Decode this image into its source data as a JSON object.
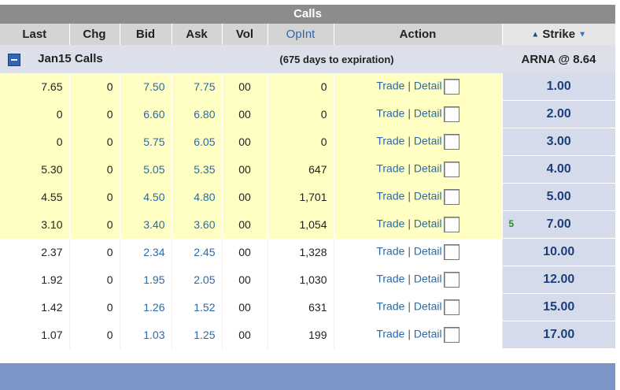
{
  "header": {
    "title": "Calls"
  },
  "columns": {
    "last": "Last",
    "chg": "Chg",
    "bid": "Bid",
    "ask": "Ask",
    "vol": "Vol",
    "oi": "OpInt",
    "action": "Action",
    "strike": "Strike"
  },
  "group": {
    "label": "Jan15 Calls",
    "expiration": "(675 days to expiration)",
    "underlying": "ARNA @ 8.64"
  },
  "action": {
    "trade": "Trade",
    "separator": "|",
    "detail": "Detail"
  },
  "rows": [
    {
      "last": "7.65",
      "chg": "0",
      "bid": "7.50",
      "ask": "7.75",
      "vol": "00",
      "oi": "0",
      "strike": "1.00",
      "marker": ""
    },
    {
      "last": "0",
      "chg": "0",
      "bid": "6.60",
      "ask": "6.80",
      "vol": "00",
      "oi": "0",
      "strike": "2.00",
      "marker": ""
    },
    {
      "last": "0",
      "chg": "0",
      "bid": "5.75",
      "ask": "6.05",
      "vol": "00",
      "oi": "0",
      "strike": "3.00",
      "marker": ""
    },
    {
      "last": "5.30",
      "chg": "0",
      "bid": "5.05",
      "ask": "5.35",
      "vol": "00",
      "oi": "647",
      "strike": "4.00",
      "marker": ""
    },
    {
      "last": "4.55",
      "chg": "0",
      "bid": "4.50",
      "ask": "4.80",
      "vol": "00",
      "oi": "1,701",
      "strike": "5.00",
      "marker": ""
    },
    {
      "last": "3.10",
      "chg": "0",
      "bid": "3.40",
      "ask": "3.60",
      "vol": "00",
      "oi": "1,054",
      "strike": "7.00",
      "marker": "5"
    },
    {
      "last": "2.37",
      "chg": "0",
      "bid": "2.34",
      "ask": "2.45",
      "vol": "00",
      "oi": "1,328",
      "strike": "10.00",
      "marker": ""
    },
    {
      "last": "1.92",
      "chg": "0",
      "bid": "1.95",
      "ask": "2.05",
      "vol": "00",
      "oi": "1,030",
      "strike": "12.00",
      "marker": ""
    },
    {
      "last": "1.42",
      "chg": "0",
      "bid": "1.26",
      "ask": "1.52",
      "vol": "00",
      "oi": "631",
      "strike": "15.00",
      "marker": ""
    },
    {
      "last": "1.07",
      "chg": "0",
      "bid": "1.03",
      "ask": "1.25",
      "vol": "00",
      "oi": "199",
      "strike": "17.00",
      "marker": ""
    }
  ],
  "colors": {
    "in_the_money": "#ffffc4",
    "out_of_money": "#ffffff",
    "strike_bg": "#d5dbea",
    "link": "#2a6aa8"
  }
}
